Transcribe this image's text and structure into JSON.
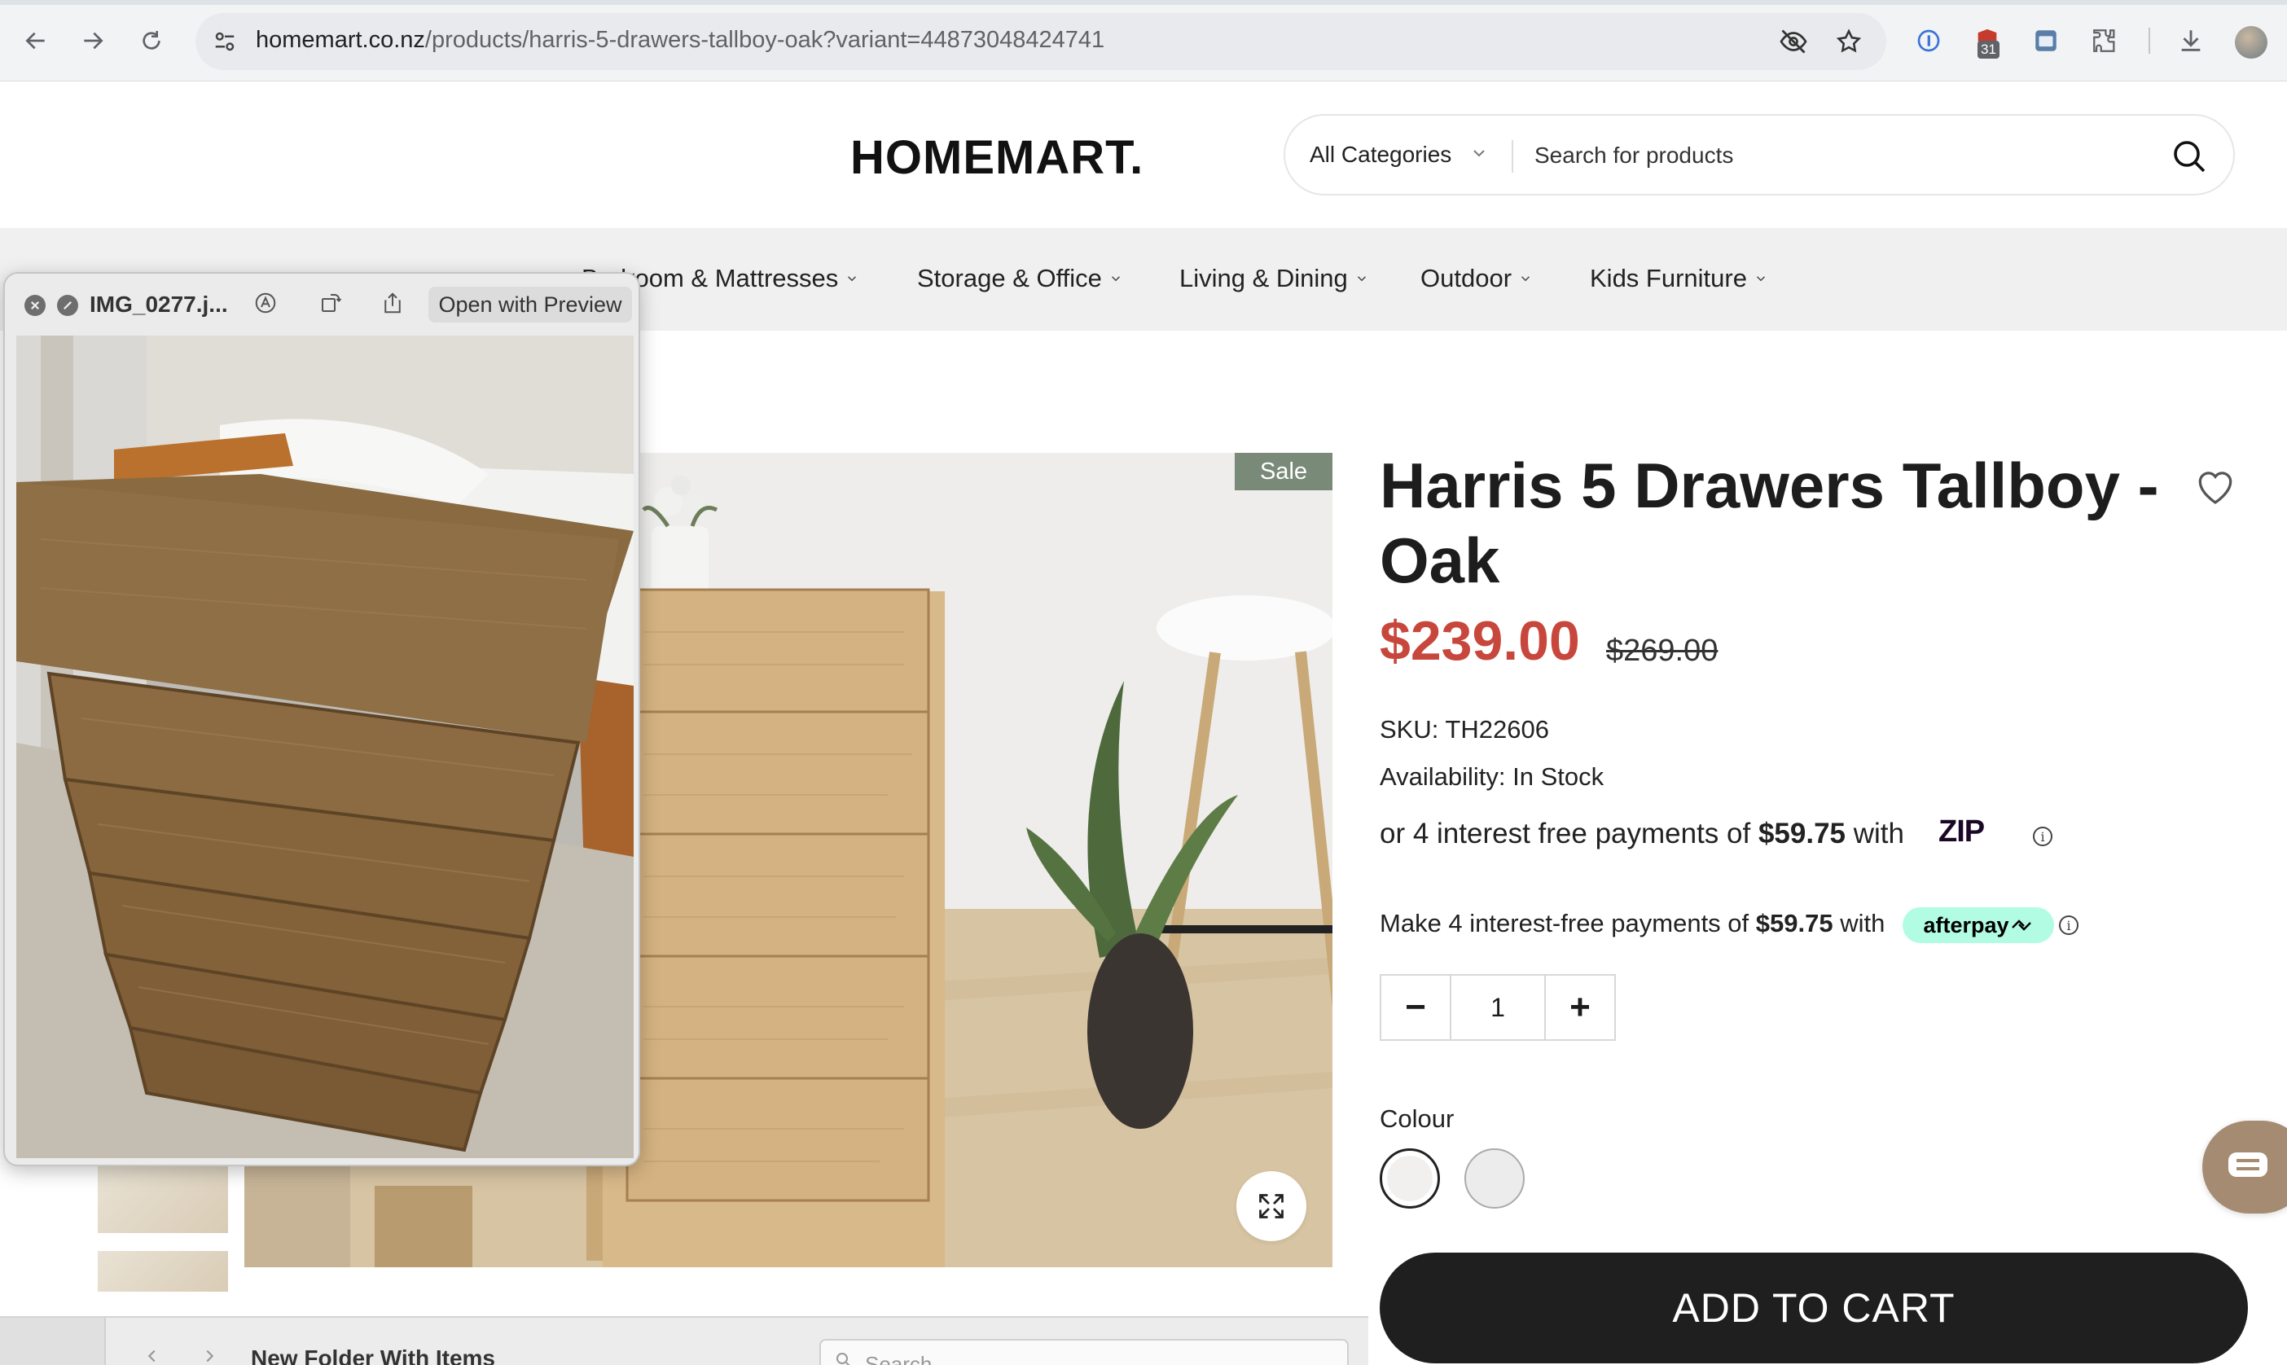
{
  "browser": {
    "url_host": "homemart.co.nz",
    "url_path": "/products/harris-5-drawers-tallboy-oak?variant=44873048424741",
    "extension_badge": "31",
    "icons": [
      "back-icon",
      "forward-icon",
      "reload-icon",
      "site-settings-icon",
      "eye-off-icon",
      "star-icon",
      "password-manager-icon",
      "extension-shield-icon",
      "extension-window-icon",
      "extensions-puzzle-icon",
      "download-icon",
      "profile-avatar"
    ]
  },
  "header": {
    "logo": "HOMEMART.",
    "category_select": "All Categories",
    "search_placeholder": "Search for products"
  },
  "nav": {
    "items": [
      {
        "label": "Bedroom & Mattresses"
      },
      {
        "label": "Storage & Office"
      },
      {
        "label": "Living & Dining"
      },
      {
        "label": "Outdoor"
      },
      {
        "label": "Kids Furniture"
      }
    ]
  },
  "product": {
    "badge": "Sale",
    "title": "Harris 5 Drawers Tallboy - Oak",
    "price": "$239.00",
    "old_price": "$269.00",
    "sku": "SKU: TH22606",
    "availability": "Availability: In Stock",
    "zip": {
      "prefix": "or 4 interest free payments of ",
      "amount": "$59.75",
      "suffix": " with",
      "logo": "ZIP"
    },
    "afterpay": {
      "prefix": "Make 4 interest-free payments of ",
      "amount": "$59.75",
      "suffix": " with",
      "logo": "afterpay"
    },
    "quantity": "1",
    "colour_label": "Colour",
    "add_to_cart": "ADD TO CART"
  },
  "quicklook": {
    "filename": "IMG_0277.j...",
    "open_button": "Open with Preview"
  },
  "finder": {
    "folder_title": "New Folder With Items",
    "search_placeholder": "Search"
  },
  "colors": {
    "sale_red": "#c8473c",
    "cart_button": "#1f1f1f",
    "afterpay_mint": "#b2fce4",
    "sale_badge": "#7a8a78"
  }
}
